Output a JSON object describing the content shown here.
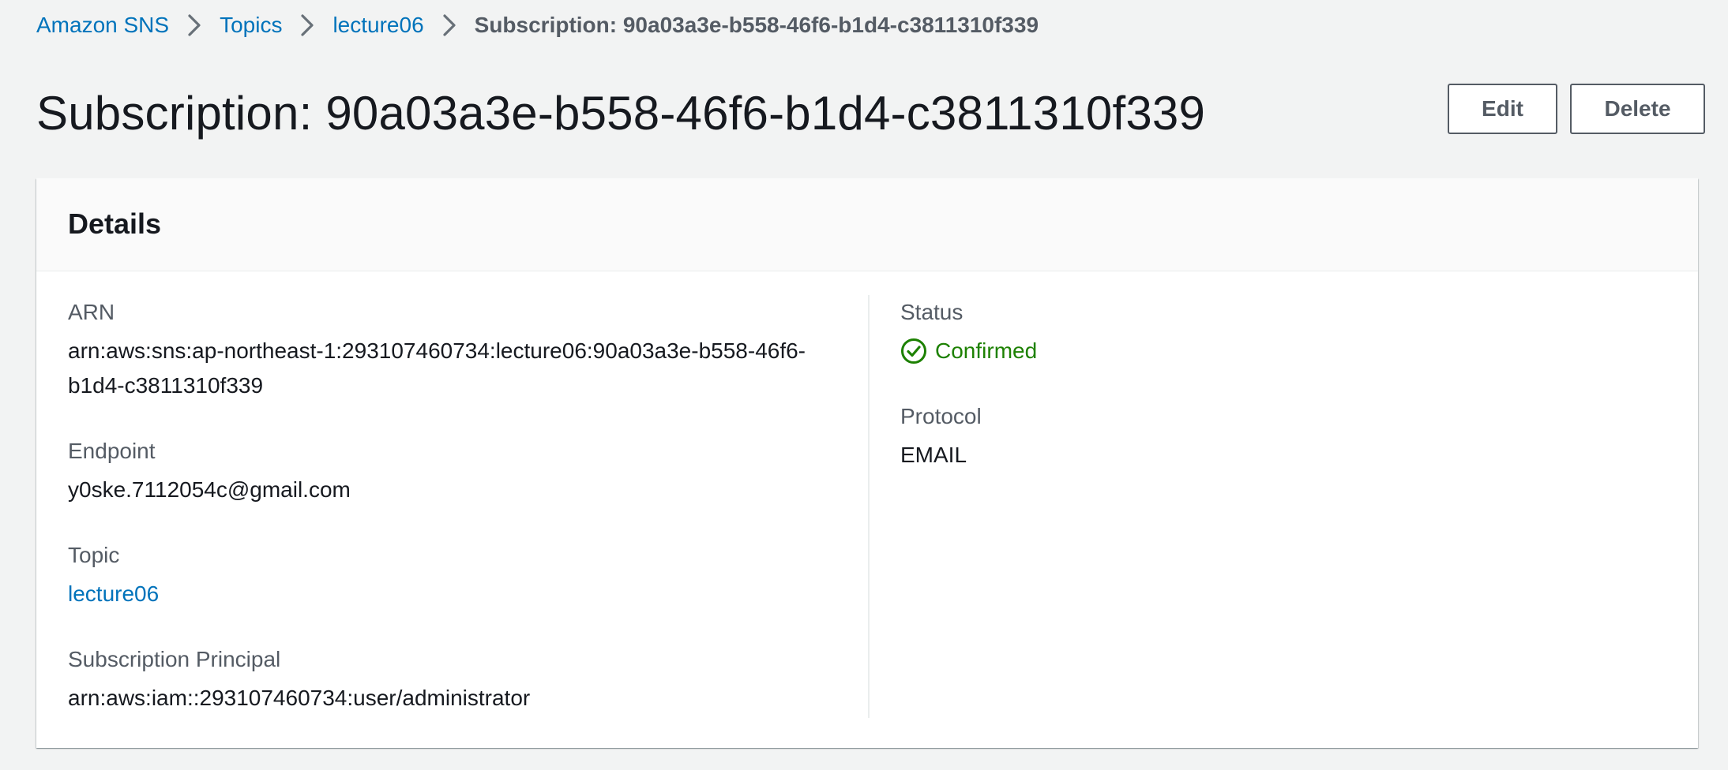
{
  "breadcrumb": {
    "items": [
      "Amazon SNS",
      "Topics",
      "lecture06"
    ],
    "current": "Subscription: 90a03a3e-b558-46f6-b1d4-c3811310f339"
  },
  "header": {
    "title": "Subscription: 90a03a3e-b558-46f6-b1d4-c3811310f339",
    "edit_label": "Edit",
    "delete_label": "Delete"
  },
  "details": {
    "title": "Details",
    "arn": {
      "label": "ARN",
      "value_line1": "arn:aws:sns:ap-northeast-1:293107460734:lecture06:90a03a3e-b558-46f6-",
      "value_line2": "b1d4-c3811310f339"
    },
    "endpoint": {
      "label": "Endpoint",
      "value": "y0ske.7112054c@gmail.com"
    },
    "topic": {
      "label": "Topic",
      "value": "lecture06"
    },
    "principal": {
      "label": "Subscription Principal",
      "value": "arn:aws:iam::293107460734:user/administrator"
    },
    "status": {
      "label": "Status",
      "value": "Confirmed",
      "icon": "check-circle-icon"
    },
    "protocol": {
      "label": "Protocol",
      "value": "EMAIL"
    }
  },
  "colors": {
    "link": "#0073bb",
    "success": "#1d8102",
    "background": "#f2f3f3",
    "label": "#545b64"
  }
}
